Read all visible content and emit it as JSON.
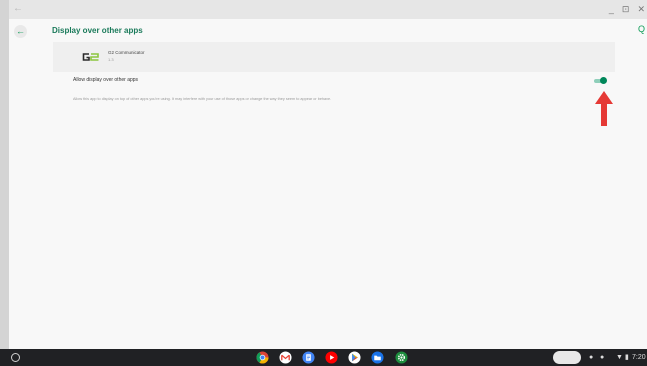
{
  "titlebar": {
    "back_glyph": "←",
    "minimize_glyph": "_",
    "restore_glyph": "⊡",
    "close_glyph": "✕"
  },
  "appbar": {
    "back_glyph": "←",
    "title": "Display over other apps",
    "search_glyph": "Q"
  },
  "app": {
    "name": "G2 Communicator",
    "version": "1.3"
  },
  "setting": {
    "title": "Allow display over other apps",
    "description": "Allow this app to display on top of other apps you're using. It may interfere with your use of those apps or change the way they seem to appear or behave.",
    "enabled": true
  },
  "colors": {
    "accent": "#0f9d58",
    "toggle_thumb": "#00875a",
    "arrow": "#e53935"
  },
  "shelf": {
    "apps": [
      "chrome-icon",
      "gmail-icon",
      "docs-icon",
      "youtube-icon",
      "play-store-icon",
      "files-icon",
      "settings-icon"
    ],
    "time": "7:20"
  }
}
